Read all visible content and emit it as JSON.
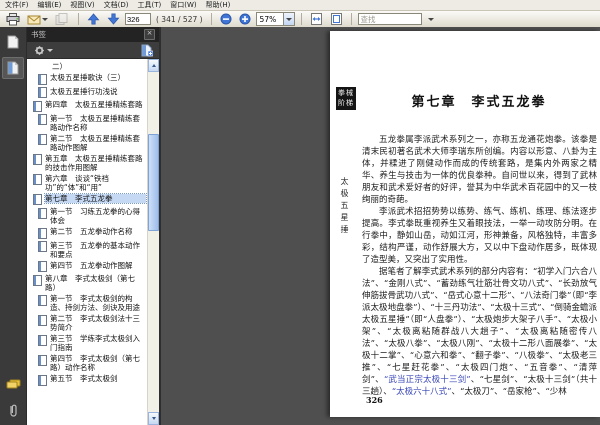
{
  "menu_bar": {
    "items": [
      "文件(F)",
      "编辑(E)",
      "视图(V)",
      "文档(D)",
      "工具(T)",
      "窗口(W)",
      "帮助(H)"
    ]
  },
  "toolbar": {
    "page_value": "326",
    "page_count": "( 341 / 527 )",
    "zoom_value": "57%",
    "find_placeholder": "查找"
  },
  "sidebar": {
    "title": "书签",
    "items": [
      {
        "label": "二）",
        "level": 2,
        "icon": false
      },
      {
        "label": "太极五星捶歌诀（三）",
        "level": 2
      },
      {
        "label": "太极五星捶行功浅说",
        "level": 2
      },
      {
        "label": "第四章　太极五星捶精练套路",
        "level": 1
      },
      {
        "label": "第一节　太极五星捶精练套路动作名称",
        "level": 2
      },
      {
        "label": "第二节　太极五星捶精练套路动作图解",
        "level": 2
      },
      {
        "label": "第五章　太极五星捶精练套路的技击作用图解",
        "level": 1
      },
      {
        "label": "第六章　谈谈“铁裆功”的“体”和“用”",
        "level": 1
      },
      {
        "label": "第七章　李式五龙拳",
        "level": 1,
        "selected": true
      },
      {
        "label": "第一节　习练五龙拳的心得体会",
        "level": 2
      },
      {
        "label": "第二节　五龙拳动作名称",
        "level": 2
      },
      {
        "label": "第三节　五龙拳的基本动作和要点",
        "level": 2
      },
      {
        "label": "第四节　五龙拳动作图解",
        "level": 2
      },
      {
        "label": "第八章　李式太极剑（第七路）",
        "level": 1
      },
      {
        "label": "第一节　李式太极剑的构造、持剑方法、剑诀及用途",
        "level": 2
      },
      {
        "label": "第二节　李式太极剑法十三势简介",
        "level": 2
      },
      {
        "label": "第三节　学练李式太极剑入门指南",
        "level": 2
      },
      {
        "label": "第四节　李式太极剑（第七路）动作名称",
        "level": 2
      },
      {
        "label": "第五节　李式太极剑",
        "level": 2
      }
    ]
  },
  "page": {
    "seal_line1": "拳械",
    "seal_line2": "阶梯",
    "margin_title": "太极五星捶",
    "chapter_title": "第七章　李式五龙拳",
    "p1": "五龙拳属李派武术系列之一，亦称五龙通花炮拳。该拳是清末民初著名武术大师李瑞东所创编。内容以形意、八卦为主体，并糅进了刚健动作而成的传统套路，是集内外两家之精华、养生与技击为一体的优良拳种。自问世以来，得到了武林朋友和武术爱好者的好评，誉其为中华武术百花园中的又一枝绚丽的奇葩。",
    "p2": "李派武术招招势势以练势、练气、练机、练理、练法逐步提高。李式拳既重视养生又着眼技法，一举一动攻防分明。在行拳中，静如山岳，动如江河，形神兼备，风格独特，丰富多彩，结构严谨，动作舒展大方，又以中下盘动作居多，既体现了造型美，又突出了实用性。",
    "p3_before": "据笔者了解李式武术系列的部分内容有：“初学入门六合八法”、“金刚八式”、“蓄劲练气壮筋壮骨文功八式”、“长劲放气伸筋拔骨武功八式”、“岳式心意十二形”、“八法奇门拳”（即“李派太极地盘拳”）、“十三丹功法”、“太极十三式”、“倒骑金蟾派太极五星捶”（即“人盘拳”）、“太极炮步大架子八手”、“太极小架”、“太极离粘随群战八大趟子”、“太极离粘随密传八法”、“太极八拳”、“太极八刚”、“太极十二形八面展拳”、“太极十二掌”、“心意六和拳”、“翻子拳”、“八极拳”、“太极老三推”、“七星赶花拳”、“太极四门炮”、“五音拳”、“清萍剑”、",
    "p3_link1": "“武当正宗太极十三剑”",
    "p3_mid": "、“七星剑”、“太极十三剑”（共十三趟）、",
    "p3_link2": "“太极六十八式”",
    "p3_after": "、“太极刀”、“岳家枪”、“少林",
    "page_number": "326"
  },
  "colors": {
    "selection_highlight": "#c6d9f4",
    "link_blue": "#3947b8",
    "toolbar_arrow_blue": "#3f6fce",
    "dark_chrome": "#3a3a3a"
  }
}
